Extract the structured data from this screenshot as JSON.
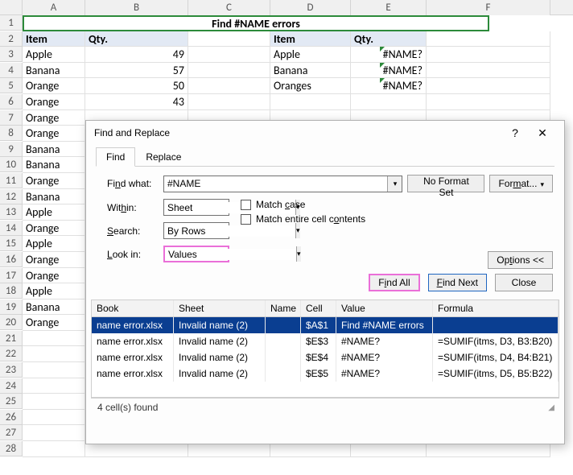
{
  "title_cell": "Find #NAME errors",
  "columns": [
    "A",
    "B",
    "C",
    "D",
    "E",
    "F"
  ],
  "sheet": {
    "headers_left": {
      "item": "Item",
      "qty": "Qty."
    },
    "headers_right": {
      "item": "Item",
      "qty": "Qty."
    },
    "rows_left": [
      {
        "item": "Apple",
        "qty": "49"
      },
      {
        "item": "Banana",
        "qty": "57"
      },
      {
        "item": "Orange",
        "qty": "50"
      },
      {
        "item": "Orange",
        "qty": "43"
      },
      {
        "item": "Orange",
        "qty": ""
      },
      {
        "item": "Orange",
        "qty": ""
      },
      {
        "item": "Banana",
        "qty": ""
      },
      {
        "item": "Banana",
        "qty": ""
      },
      {
        "item": "Orange",
        "qty": ""
      },
      {
        "item": "Banana",
        "qty": ""
      },
      {
        "item": "Apple",
        "qty": ""
      },
      {
        "item": "Orange",
        "qty": ""
      },
      {
        "item": "Apple",
        "qty": ""
      },
      {
        "item": "Orange",
        "qty": ""
      },
      {
        "item": "Orange",
        "qty": ""
      },
      {
        "item": "Apple",
        "qty": ""
      },
      {
        "item": "Banana",
        "qty": ""
      },
      {
        "item": "Orange",
        "qty": ""
      }
    ],
    "rows_right": [
      {
        "item": "Apple",
        "qty": "#NAME?"
      },
      {
        "item": "Banana",
        "qty": "#NAME?"
      },
      {
        "item": "Oranges",
        "qty": "#NAME?"
      }
    ],
    "total_visible_rows": 28
  },
  "dialog": {
    "title": "Find and Replace",
    "help_icon": "?",
    "close_icon": "✕",
    "tabs": {
      "find": "Find",
      "replace": "Replace"
    },
    "find_what_label": "Find what:",
    "find_what_value": "#NAME",
    "no_format": "No Format Set",
    "format_btn": "Format...",
    "within_label": "Within:",
    "within_value": "Sheet",
    "search_label": "Search:",
    "search_value": "By Rows",
    "lookin_label": "Look in:",
    "lookin_value": "Values",
    "match_case": "Match case",
    "match_entire": "Match entire cell contents",
    "options_btn": "Options <<",
    "find_all": "Find All",
    "find_next": "Find Next",
    "close": "Close",
    "results_headers": {
      "book": "Book",
      "sheet": "Sheet",
      "name": "Name",
      "cell": "Cell",
      "value": "Value",
      "formula": "Formula"
    },
    "results": [
      {
        "book": "name error.xlsx",
        "sheet": "Invalid name (2)",
        "name": "",
        "cell": "$A$1",
        "value": "Find #NAME errors",
        "formula": ""
      },
      {
        "book": "name error.xlsx",
        "sheet": "Invalid name (2)",
        "name": "",
        "cell": "$E$3",
        "value": "#NAME?",
        "formula": "=SUMIF(itms, D3, B3:B20)"
      },
      {
        "book": "name error.xlsx",
        "sheet": "Invalid name (2)",
        "name": "",
        "cell": "$E$4",
        "value": "#NAME?",
        "formula": "=SUMIF(itms, D4, B4:B21)"
      },
      {
        "book": "name error.xlsx",
        "sheet": "Invalid name (2)",
        "name": "",
        "cell": "$E$5",
        "value": "#NAME?",
        "formula": "=SUMIF(itms, D5, B5:B22)"
      }
    ],
    "status": "4 cell(s) found"
  }
}
